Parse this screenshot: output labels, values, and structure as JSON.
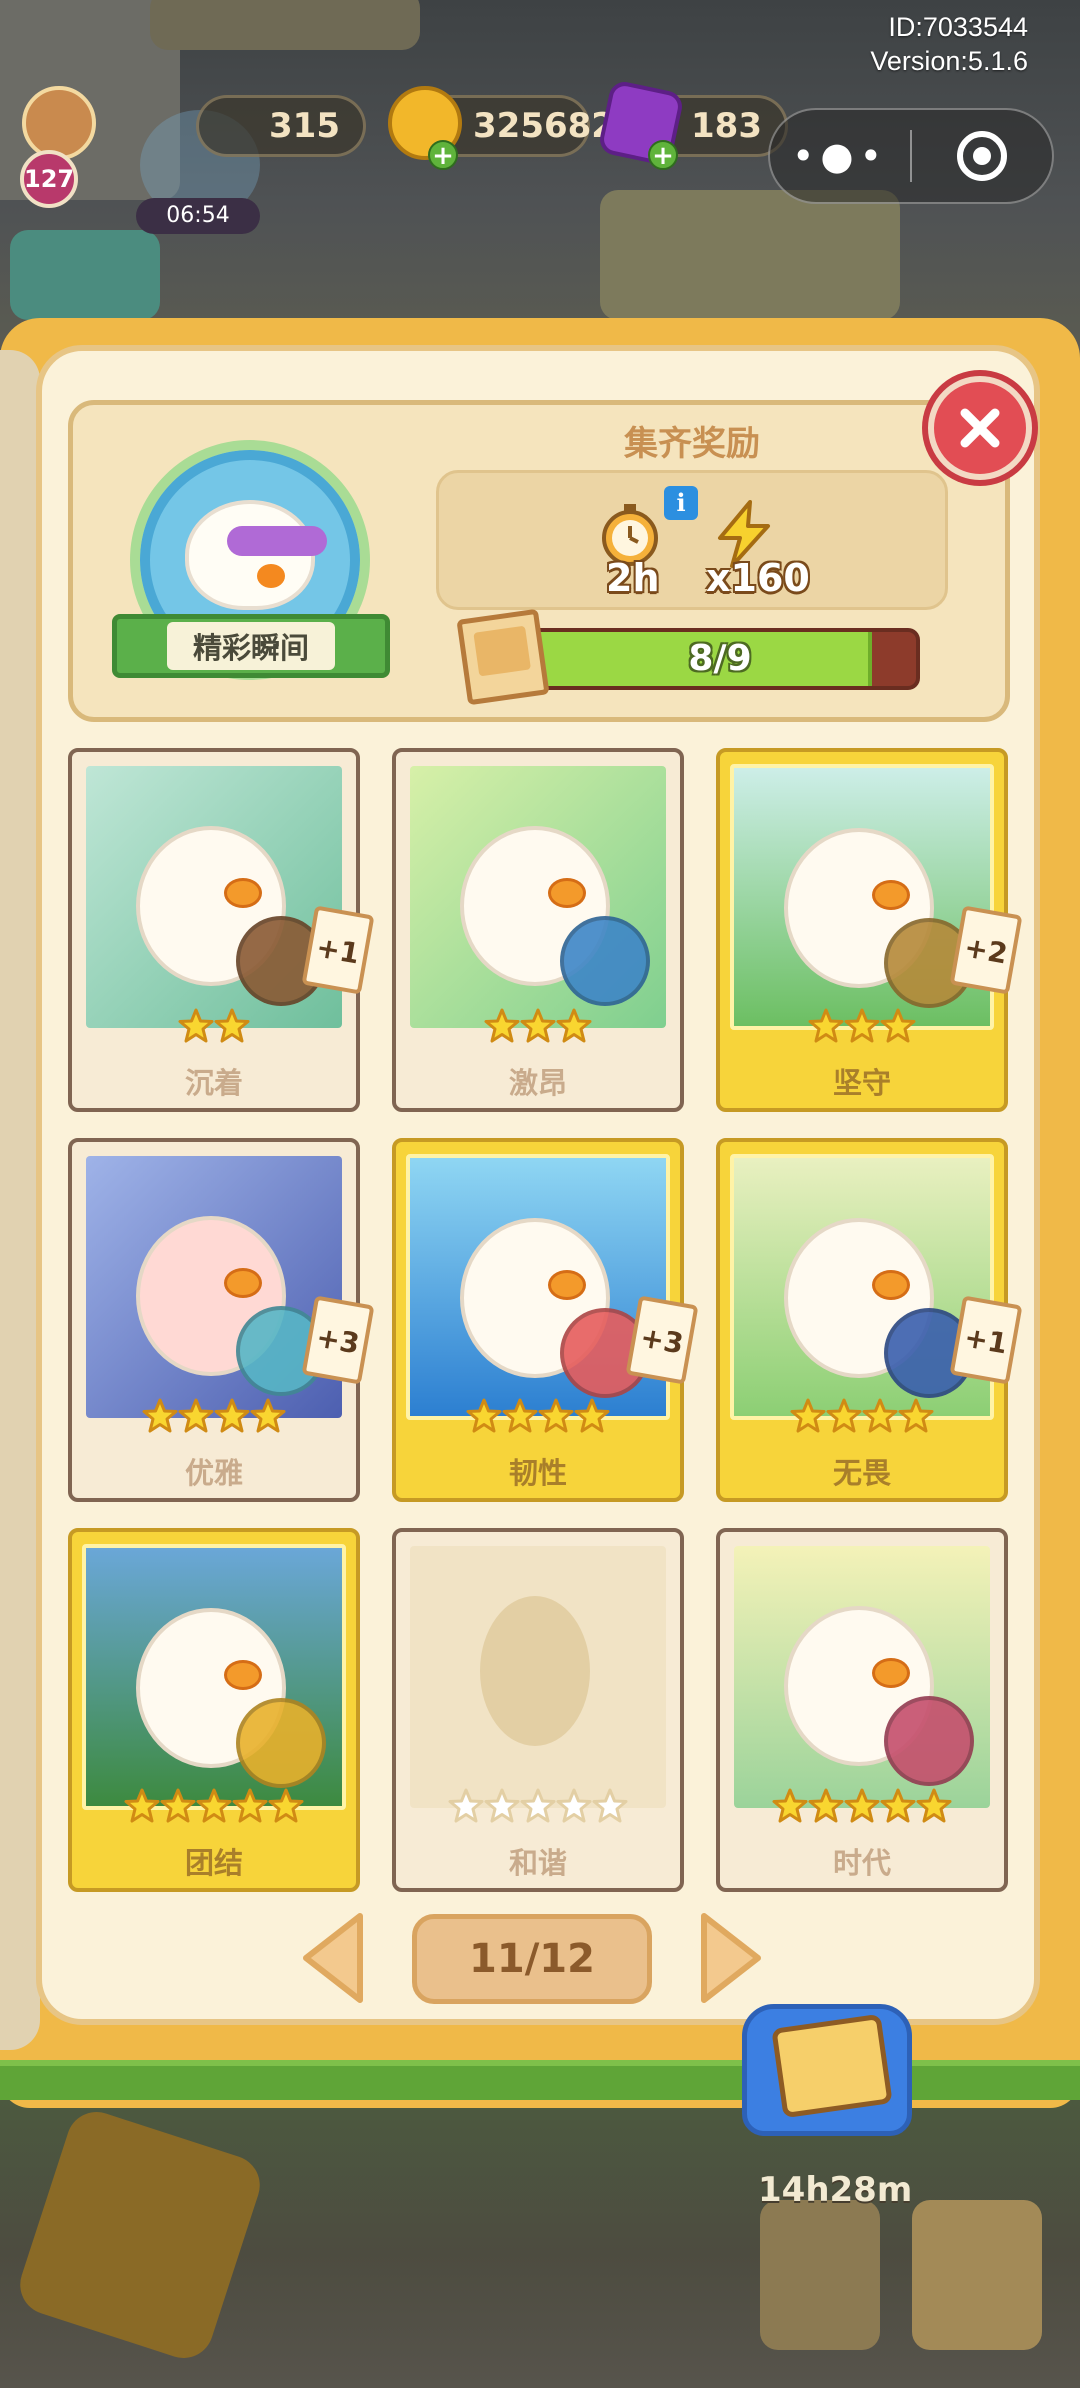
{
  "status": {
    "id_text": "ID:7033544",
    "version_text": "Version:5.1.6"
  },
  "hud": {
    "level": "127",
    "event_timer": "06:54",
    "energy": "315",
    "coins": "325682",
    "gems": "183"
  },
  "mini_program_capsule": {
    "more_glyph": "•●•",
    "close_glyph": "◎"
  },
  "album": {
    "title": "精彩瞬间",
    "reward_title": "集齐奖励",
    "rewards": [
      {
        "icon": "stopwatch-icon",
        "value": "2h"
      },
      {
        "icon": "lightning-icon",
        "value": "x160"
      }
    ],
    "progress": {
      "collected": 8,
      "total": 9,
      "label": "8/9",
      "fraction": 0.889
    },
    "cards": [
      {
        "label": "沉着",
        "stars": 2,
        "plus": "+1",
        "owned": true,
        "gold": false
      },
      {
        "label": "激昂",
        "stars": 3,
        "plus": "",
        "owned": true,
        "gold": false
      },
      {
        "label": "坚守",
        "stars": 3,
        "plus": "+2",
        "owned": true,
        "gold": true
      },
      {
        "label": "优雅",
        "stars": 4,
        "plus": "+3",
        "owned": true,
        "gold": false
      },
      {
        "label": "韧性",
        "stars": 4,
        "plus": "+3",
        "owned": true,
        "gold": true
      },
      {
        "label": "无畏",
        "stars": 4,
        "plus": "+1",
        "owned": true,
        "gold": true
      },
      {
        "label": "团结",
        "stars": 5,
        "plus": "",
        "owned": true,
        "gold": true
      },
      {
        "label": "和谐",
        "stars": 5,
        "plus": "",
        "owned": false,
        "gold": false
      },
      {
        "label": "时代",
        "stars": 5,
        "plus": "",
        "owned": true,
        "gold": false
      }
    ],
    "page_indicator": "11/12"
  },
  "bottom": {
    "timer": "14h28m"
  },
  "colors": {
    "page_bg": "#fbf2d9",
    "book_frame": "#f0b948",
    "gold_card": "#f7d43a",
    "progress_fill": "#9bd844",
    "close_red": "#e24d54"
  }
}
